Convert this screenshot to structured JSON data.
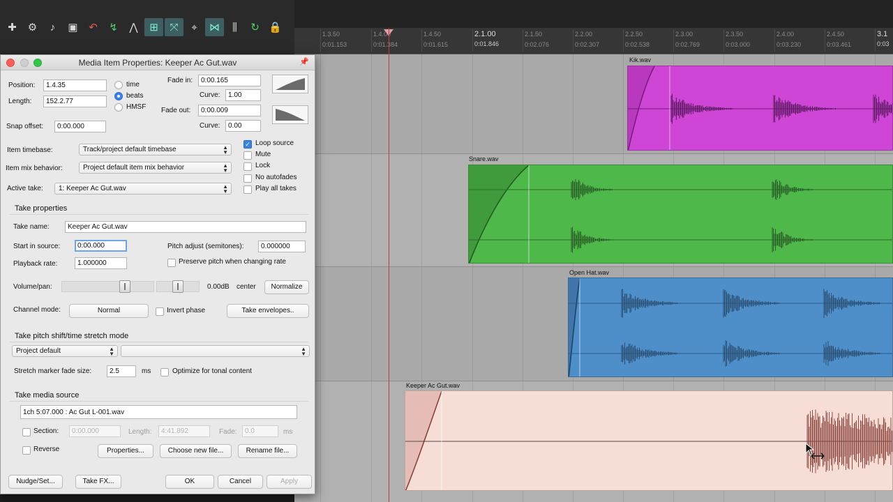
{
  "toolbar": {
    "icons": [
      "new-project-icon",
      "settings-icon",
      "metronome-icon",
      "save-icon",
      "undo-icon",
      "ripple-edit-icon",
      "envelope-icon",
      "grid-snap-icon",
      "cross-item-icon",
      "locking-icon",
      "trim-icon",
      "grid-icon",
      "loop-icon",
      "lock-icon"
    ]
  },
  "ruler": {
    "ticks": [
      {
        "beat": "1.3.50",
        "time": "0:01.153"
      },
      {
        "beat": "1.4.00",
        "time": "0:01.384"
      },
      {
        "beat": "1.4.50",
        "time": "0:01.615"
      },
      {
        "beat": "2.1.00",
        "time": "0:01.846"
      },
      {
        "beat": "2.1.50",
        "time": "0:02.076"
      },
      {
        "beat": "2.2.00",
        "time": "0:02.307"
      },
      {
        "beat": "2.2.50",
        "time": "0:02.538"
      },
      {
        "beat": "2.3.00",
        "time": "0:02.769"
      },
      {
        "beat": "2.3.50",
        "time": "0:03.000"
      },
      {
        "beat": "2.4.00",
        "time": "0:03.230"
      },
      {
        "beat": "2.4.50",
        "time": "0:03.461"
      },
      {
        "beat": "3.1",
        "time": "0:03"
      }
    ]
  },
  "items": {
    "kik": {
      "name": "Kik.wav",
      "color": "#cf46d6"
    },
    "snare": {
      "name": "Snare.wav",
      "color": "#4eb84a"
    },
    "openhat": {
      "name": "Open Hat.wav",
      "color": "#4f8fc9"
    },
    "keeper": {
      "name": "Keeper Ac Gut.wav",
      "color": "#f6ddd6"
    }
  },
  "dialog": {
    "title": "Media Item Properties:  Keeper Ac Gut.wav",
    "position_label": "Position:",
    "position_value": "1.4.35",
    "length_label": "Length:",
    "length_value": "152.2.77",
    "format_options": [
      "time",
      "beats",
      "HMSF"
    ],
    "format_selected": "beats",
    "fade_in_label": "Fade in:",
    "fade_in_value": "0:00.165",
    "curve_label": "Curve:",
    "fade_in_curve": "1.00",
    "fade_out_label": "Fade out:",
    "fade_out_value": "0:00.009",
    "fade_out_curve": "0.00",
    "snap_offset_label": "Snap offset:",
    "snap_offset_value": "0:00.000",
    "timebase_label": "Item timebase:",
    "timebase_value": "Track/project default timebase",
    "mix_label": "Item mix behavior:",
    "mix_value": "Project default item mix behavior",
    "active_take_label": "Active take:",
    "active_take_value": "1: Keeper Ac Gut.wav",
    "checks": {
      "loop_source": "Loop source",
      "mute": "Mute",
      "lock": "Lock",
      "no_autofades": "No autofades",
      "play_all_takes": "Play all takes"
    },
    "take_properties": "Take properties",
    "take_name_label": "Take name:",
    "take_name_value": "Keeper Ac Gut.wav",
    "start_label": "Start in source:",
    "start_value": "0:00.000",
    "pitch_label": "Pitch adjust (semitones):",
    "pitch_value": "0.000000",
    "rate_label": "Playback rate:",
    "rate_value": "1.000000",
    "preserve_pitch": "Preserve pitch when changing rate",
    "volpan_label": "Volume/pan:",
    "volume_db": "0.00dB",
    "pan_value": "center",
    "normalize": "Normalize",
    "channel_label": "Channel mode:",
    "channel_value": "Normal",
    "invert_phase": "Invert phase",
    "take_envelopes": "Take envelopes..",
    "pitch_shift_title": "Take pitch shift/time stretch mode",
    "pitch_shift_value": "Project default",
    "stretch_label": "Stretch marker fade size:",
    "stretch_value": "2.5",
    "stretch_unit": "ms",
    "optimize": "Optimize for tonal content",
    "media_source_title": "Take media source",
    "media_source_value": "1ch 5:07.000 : Ac Gut L-001.wav",
    "section_label": "Section:",
    "section_value": "0:00.000",
    "length2_label": "Length:",
    "length2_value": "4:41.892",
    "fade_label": "Fade:",
    "fade_value": "0.0",
    "fade_unit": "ms",
    "reverse": "Reverse",
    "properties_btn": "Properties...",
    "choose_btn": "Choose new file...",
    "rename_btn": "Rename file...",
    "nudge_btn": "Nudge/Set...",
    "takefx_btn": "Take FX...",
    "ok_btn": "OK",
    "cancel_btn": "Cancel",
    "apply_btn": "Apply"
  }
}
